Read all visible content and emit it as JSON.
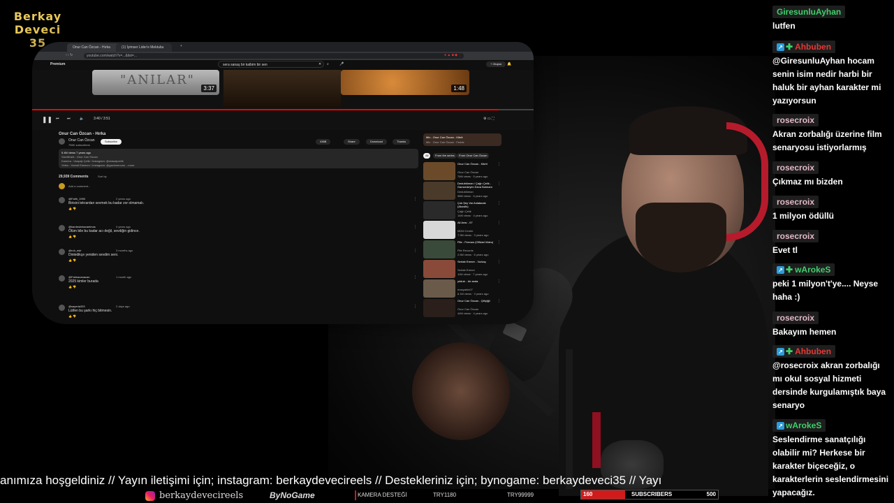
{
  "logo": {
    "line1": "Berkay",
    "line2": "Deveci",
    "line3": "35"
  },
  "browser": {
    "tabs": [
      "Onur Can Özcan - Hırka",
      "(1) İyimser Lider'e Mektubu"
    ],
    "url": "youtube.com/watch?v=...&list=...",
    "search_value": "sera sanaş bir kalbim bir sen",
    "premium_label": "Premium",
    "create_label": "+ Oluştur",
    "thumb1": {
      "text": "\"ANILAR\"",
      "duration": "3:37"
    },
    "thumb2": {
      "duration": "1:48"
    },
    "progress": 0.93,
    "time": "3:40 / 3:51",
    "video_title": "Onur Can Özcan - Hırka",
    "channel": "Onur Can Özcan",
    "subs": "756K subscribers",
    "subscribe_label": "Subscribe",
    "likes": "436B",
    "share": "Share",
    "download": "Download",
    "thanks": "Thanks",
    "desc": [
      "5.4M views  7 years ago",
      "Söz/Müzik : Onur Can Özcan",
      "Kamera : Ulaşalp Çelik / İnstagram: @ulasalpcelik",
      "Video : Hamdi Ekemen / İnstagram: @gsekmenvan ...more"
    ],
    "comments_count": "29,939 Comments",
    "sort_label": "Sort by",
    "add_comment": "Add a comment...",
    "comments": [
      {
        "user": "@Fatih_1990",
        "meta": "2 years ago",
        "text": "Birisini tekrardan sevmek bu kadar zor olmamalı."
      },
      {
        "user": "@kardesimkaraelmas",
        "meta": "4 years ago",
        "text": "Ölüm bile bu kadar acı değil, sevdiğin gidince."
      },
      {
        "user": "@ruh_esir",
        "meta": "3 months ago",
        "text": "Dinledikçe yeniden sevdim seni."
      },
      {
        "user": "@Fatmacanacan",
        "meta": "1 month ago",
        "text": "2025 kimler burada"
      },
      {
        "user": "@sayeda333",
        "meta": "2 days ago",
        "text": "Lütfen bu şarkı hiç bitmesin."
      }
    ],
    "mix_title": "Mix - Onur Can Özcan - Kibrit",
    "mix_sub": "Mix · Onur Can Özcan · Feride",
    "chips": [
      "All",
      "From the series",
      "From Onur Can Özcan"
    ],
    "related": [
      {
        "title": "Onur Can Özcan - Kibrit",
        "channel": "Onur Can Özcan",
        "meta": "76M views · 5 years ago",
        "color": "#6b4a2a"
      },
      {
        "title": "Dedublüman / Çağrı Çelik - Gamzedeyim Deva Bulmam",
        "channel": "Dedublüman",
        "meta": "98M views · 6 years ago",
        "color": "#4a3a2a"
      },
      {
        "title": "Çok Şey Var Anlatacak (Akustik)",
        "channel": "Çağrı Çelik",
        "meta": "14M views · 4 years ago",
        "color": "#2a2a2a"
      },
      {
        "title": "Ali Arav - 07",
        "channel": "MDM Center",
        "meta": "7.9M views · 3 years ago",
        "color": "#d8d8d8"
      },
      {
        "title": "Pile - Ferman (Official Video)",
        "channel": "Pile Records",
        "meta": "2.5M views · 6 years ago",
        "color": "#3a4a3a"
      },
      {
        "title": "Sertab Erener - Vurkaç",
        "channel": "Sertab Erener",
        "meta": "11M views · 7 years ago",
        "color": "#8a4a3a"
      },
      {
        "title": "yıldızlı - bir anda",
        "channel": "erasyahin07",
        "meta": "8.1M views · 3 years ago",
        "color": "#6a5a4a"
      },
      {
        "title": "Onur Can Özcan - Çiftçiğil",
        "channel": "Onur Can Özcan",
        "meta": "44M views · 4 years ago",
        "color": "#2a1f1a"
      }
    ]
  },
  "chat": [
    {
      "user": "GiresunluAyhan",
      "color": "#3fd06b",
      "badges": 0,
      "text": "lutfen"
    },
    {
      "user": "Ahbuben",
      "color": "#e53935",
      "badges": 2,
      "text": "@GiresunluAyhan hocam senin isim nedir harbi bir haluk bir ayhan karakter mi yazıyorsun"
    },
    {
      "user": "rosecroix",
      "color": "#e4b9c6",
      "badges": 0,
      "text": "Akran zorbalığı üzerine film senaryosu istiyorlarmış"
    },
    {
      "user": "rosecroix",
      "color": "#e4b9c6",
      "badges": 0,
      "text": "Çıkmaz mı bizden"
    },
    {
      "user": "rosecroix",
      "color": "#e4b9c6",
      "badges": 0,
      "text": "1 milyon ödüllü"
    },
    {
      "user": "rosecroix",
      "color": "#e4b9c6",
      "badges": 0,
      "text": "Evet tl"
    },
    {
      "user": "wArokeS",
      "color": "#3fd06b",
      "badges": 2,
      "text": "peki 1 milyon't'ye.... Neyse haha :)"
    },
    {
      "user": "rosecroix",
      "color": "#e4b9c6",
      "badges": 0,
      "text": "Bakayım hemen"
    },
    {
      "user": "Ahbuben",
      "color": "#e53935",
      "badges": 2,
      "text": "@rosecroix akran zorbalığı mı okul sosyal hizmeti dersinde kurgulamıştık baya senaryo"
    },
    {
      "user": "wArokeS",
      "color": "#3fd06b",
      "badges": 1,
      "text": "Seslendirme sanatçılığı olabilir mi? Herkese bir karakter biçeceğiz, o karakterlerin seslendirmesini yapacağız."
    }
  ],
  "ticker": "anımıza hoşgeldiniz // Yayın iletişimi için; instagram: berkaydevecireels // Destekleriniz için; bynogame: berkaydeveci35 // Yayı",
  "bottom": {
    "instagram": "berkaydevecireels",
    "bynogame": "ByNoGame",
    "kamera": "KAMERA DESTEĞİ",
    "goal1": "TRY1180",
    "goal2": "TRY99999",
    "sub_current": "160",
    "sub_label": "SUBSCRIBERS",
    "sub_goal": "500",
    "sub_fraction": 0.32
  }
}
